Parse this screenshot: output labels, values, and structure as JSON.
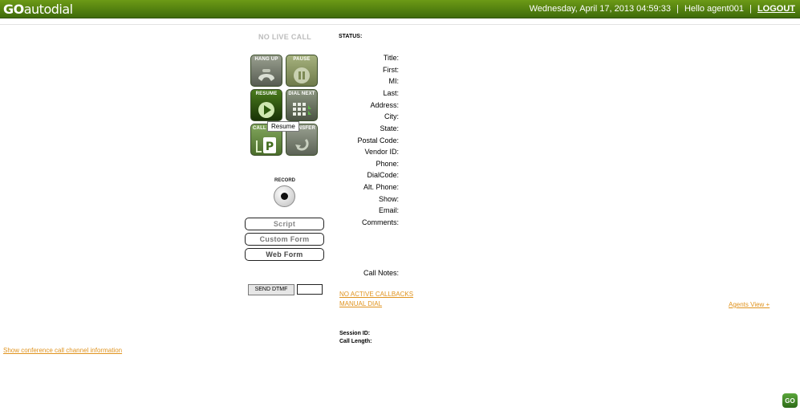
{
  "app": {
    "logo_prefix": "GO",
    "logo_suffix": "autodial",
    "datetime": "Wednesday, April 17, 2013 04:59:33",
    "greeting": "Hello agent001",
    "separator": "|",
    "logout": "LOGOUT"
  },
  "call_status": "NO LIVE CALL",
  "buttons": {
    "hangup": "HANG UP",
    "pause": "PAUSE",
    "resume": "RESUME",
    "dial_next": "DIAL NEXT",
    "park": "CALL",
    "transfer": "NSFER",
    "tooltip": "Resume"
  },
  "record": {
    "label": "RECORD"
  },
  "panels": {
    "script": "Script",
    "custom_form": "Custom Form",
    "web_form": "Web Form"
  },
  "dtmf": {
    "button": "SEND DTMF",
    "value": ""
  },
  "status": {
    "label": "STATUS:"
  },
  "fields": {
    "title": "Title:",
    "first": "First:",
    "mi": "MI:",
    "last": "Last:",
    "address": "Address:",
    "city": "City:",
    "state": "State:",
    "postal": "Postal Code:",
    "vendor": "Vendor ID:",
    "phone": "Phone:",
    "dialcode": "DialCode:",
    "alt_phone": "Alt. Phone:",
    "show": "Show:",
    "email": "Email:",
    "comments": "Comments:",
    "call_notes": "Call Notes:"
  },
  "links": {
    "no_callbacks": "NO ACTIVE CALLBACKS",
    "manual_dial": "MANUAL DIAL",
    "agents_view": "Agents View +",
    "conference_info": "Show conference call channel information"
  },
  "session": {
    "id_label": "Session ID:",
    "length_label": "Call Length:"
  },
  "badge": "GO",
  "colors": {
    "topbar": "#4f7f0f",
    "link": "#e0931e"
  }
}
